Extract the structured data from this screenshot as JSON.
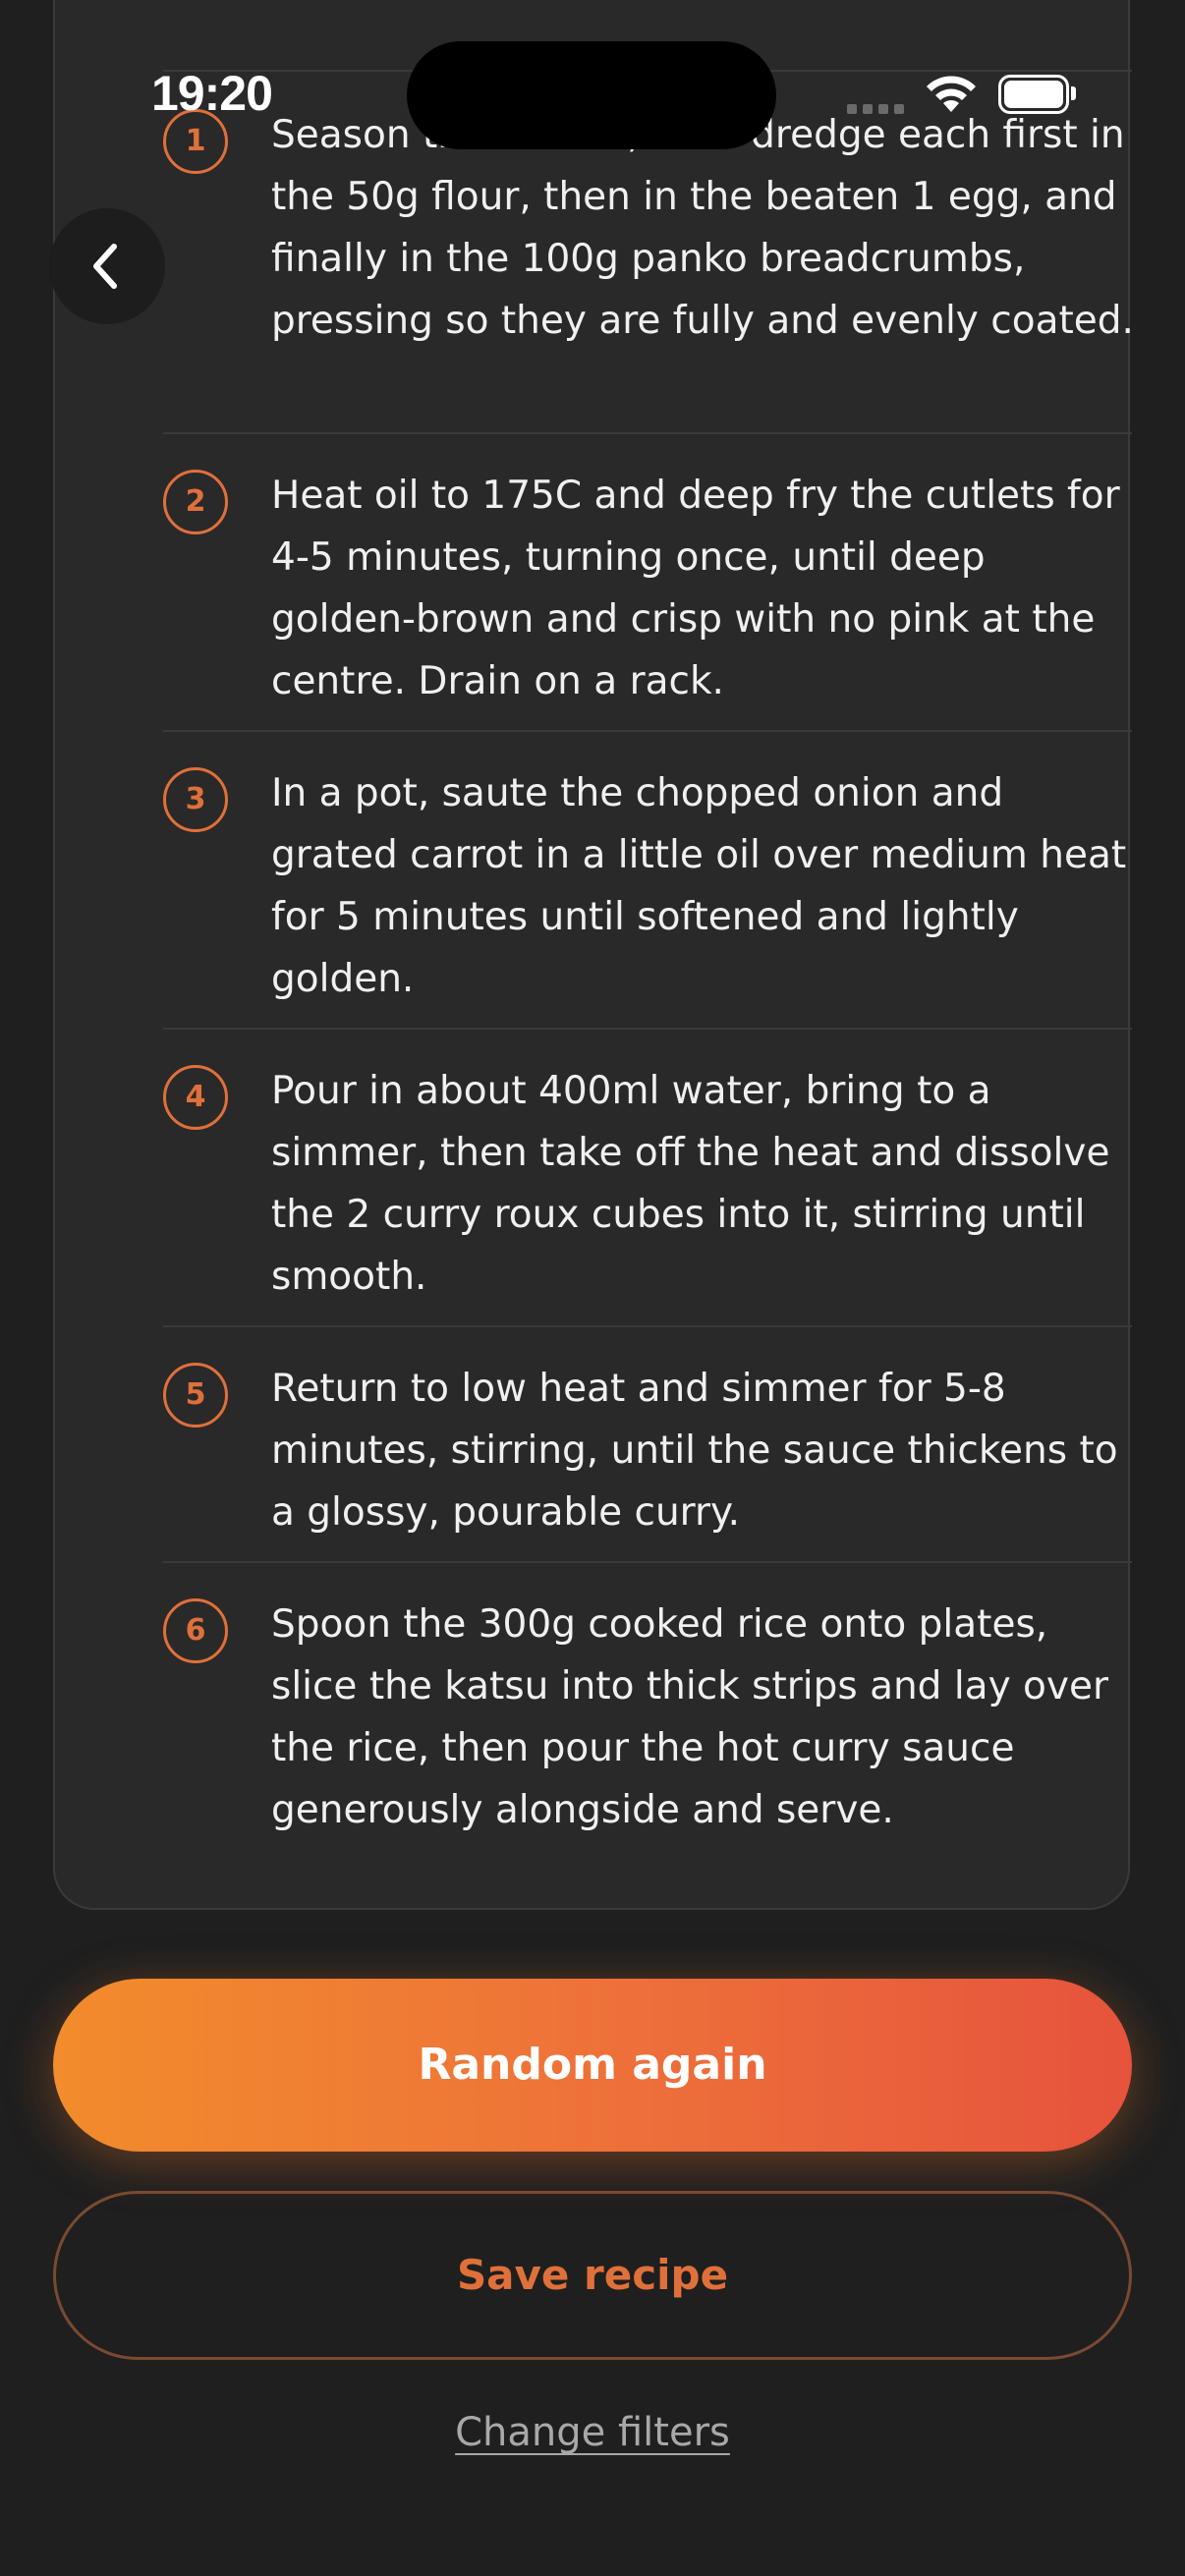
{
  "status_bar": {
    "time": "19:20",
    "wifi_icon": "wifi-icon",
    "battery_icon": "battery-full-icon"
  },
  "navigation": {
    "back_icon": "chevron-left-icon"
  },
  "steps": [
    {
      "number": "1",
      "text": "Season the cutlets, then dredge each first in the 50g flour, then in the beaten 1 egg, and finally in the 100g panko breadcrumbs, pressing so they are fully and evenly coated."
    },
    {
      "number": "2",
      "text": "Heat oil to 175C and deep fry the cutlets for 4-5 minutes, turning once, until deep golden-brown and crisp with no pink at the centre. Drain on a rack."
    },
    {
      "number": "3",
      "text": "In a pot, saute the chopped onion and grated carrot in a little oil over medium heat for 5 minutes until softened and lightly golden."
    },
    {
      "number": "4",
      "text": "Pour in about 400ml water, bring to a simmer, then take off the heat and dissolve the 2 curry roux cubes into it, stirring until smooth."
    },
    {
      "number": "5",
      "text": "Return to low heat and simmer for 5-8 minutes, stirring, until the sauce thickens to a glossy, pourable curry."
    },
    {
      "number": "6",
      "text": "Spoon the 300g cooked rice onto plates, slice the katsu into thick strips and lay over the rice, then pour the hot curry sauce generously alongside and serve."
    }
  ],
  "actions": {
    "random_again": "Random again",
    "save_recipe": "Save recipe",
    "change_filters": "Change filters"
  },
  "colors": {
    "accent": "#e0703a",
    "gradient_start": "#f28c2c",
    "gradient_end": "#e6533c",
    "background": "#1f1f1f",
    "card": "#292929"
  }
}
